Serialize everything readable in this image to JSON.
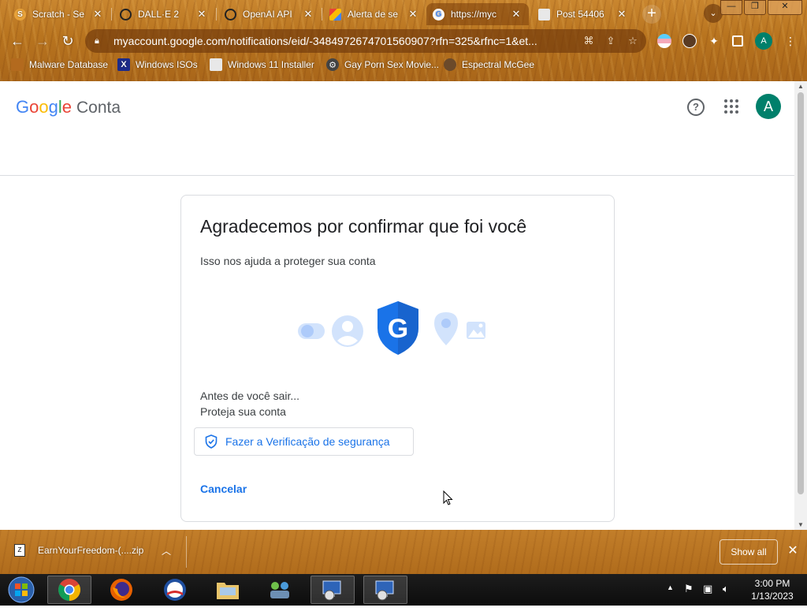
{
  "browser": {
    "tabs": [
      {
        "title": "Scratch - Se",
        "favicon": "scratch-icon",
        "active": false
      },
      {
        "title": "DALL·E 2",
        "favicon": "openai-icon",
        "active": false
      },
      {
        "title": "OpenAI API",
        "favicon": "openai-icon",
        "active": false
      },
      {
        "title": "Alerta de se",
        "favicon": "google-alert-icon",
        "active": false
      },
      {
        "title": "https://myc",
        "favicon": "google-icon",
        "active": true
      },
      {
        "title": "Post 54406",
        "favicon": "image-icon",
        "active": false
      }
    ],
    "url": "myaccount.google.com/notifications/eid/-3484972674701560907?rfn=325&rfnc=1&et...",
    "bookmarks": [
      {
        "label": "Malware Database",
        "icon": "folder-icon"
      },
      {
        "label": "Windows ISOs",
        "icon": "x-icon"
      },
      {
        "label": "Windows 11 Installer",
        "icon": "image-icon"
      },
      {
        "label": "Gay Porn Sex Movie...",
        "icon": "gear-icon"
      },
      {
        "label": "Espectral McGee",
        "icon": "avatar-icon"
      }
    ],
    "profile_initial": "A"
  },
  "header": {
    "logo_google": "Google",
    "logo_product": "Conta",
    "avatar_initial": "A"
  },
  "card": {
    "title": "Agradecemos por confirmar que foi você",
    "subtitle": "Isso nos ajuda a proteger sua conta",
    "before_line1": "Antes de você sair...",
    "before_line2": "Proteja sua conta",
    "checkup_button": "Fazer a Verificação de segurança",
    "cancel_link": "Cancelar",
    "shield_letter": "G"
  },
  "download": {
    "filename": "EarnYourFreedom-(....zip",
    "show_all": "Show all"
  },
  "taskbar": {
    "time": "3:00 PM",
    "date": "1/13/2023"
  },
  "colors": {
    "google_blue": "#4285f4",
    "google_red": "#ea4335",
    "google_yellow": "#fbbc05",
    "google_green": "#34a853",
    "link_blue": "#1a73e8",
    "avatar_green": "#00806b",
    "chrome_wood": "#b8741f"
  }
}
